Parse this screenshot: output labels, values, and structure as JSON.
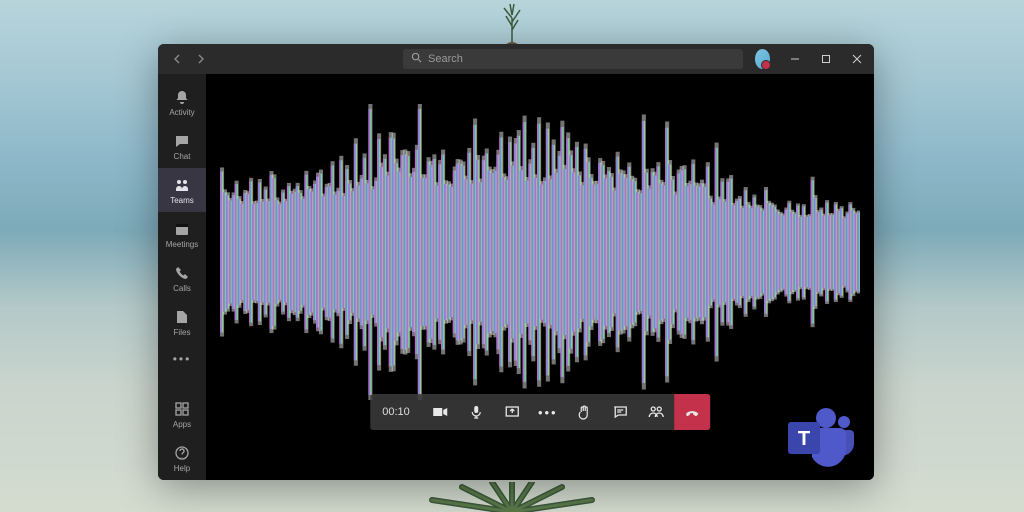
{
  "titlebar": {
    "search_placeholder": "Search"
  },
  "sidebar": {
    "items": [
      {
        "label": "Activity"
      },
      {
        "label": "Chat"
      },
      {
        "label": "Teams"
      },
      {
        "label": "Meetings"
      },
      {
        "label": "Calls"
      },
      {
        "label": "Files"
      }
    ],
    "more_label": "",
    "apps_label": "Apps",
    "help_label": "Help"
  },
  "call": {
    "duration": "00:10"
  },
  "colors": {
    "hangup": "#c4314b",
    "accent": "#5059c9",
    "window_bg": "#000000",
    "chrome_bg": "#2b2b2b",
    "sidebar_bg": "#1f1f1f"
  }
}
